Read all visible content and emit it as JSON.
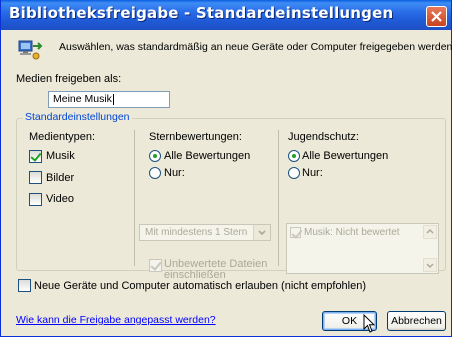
{
  "window": {
    "title": "Bibliotheksfreigabe - Standardeinstellungen"
  },
  "header": {
    "description": "Auswählen, was standardmäßig an neue Geräte oder Computer freigegeben werden soll",
    "icon": "network-share-icon"
  },
  "media_name": {
    "label": "Medien freigeben als:",
    "value": "Meine Musik"
  },
  "defaults_group": {
    "legend": "Standardeinstellungen",
    "media_types": {
      "heading": "Medientypen:",
      "items": [
        {
          "label": "Musik",
          "checked": true
        },
        {
          "label": "Bilder",
          "checked": false
        },
        {
          "label": "Video",
          "checked": false
        }
      ]
    },
    "star_ratings": {
      "heading": "Sternbewertungen:",
      "all_label": "Alle Bewertungen",
      "only_label": "Nur:",
      "selected": "all",
      "dropdown_value": "Mit mindestens 1 Stern",
      "unrated_label_line1": "Unbewertete Dateien",
      "unrated_label_line2": "einschließen",
      "unrated_checked": true
    },
    "parental": {
      "heading": "Jugendschutz:",
      "all_label": "Alle Bewertungen",
      "only_label": "Nur:",
      "selected": "all",
      "list_item": "Musik: Nicht bewertet",
      "list_item_checked": true
    }
  },
  "auto_allow": {
    "label": "Neue Geräte und Computer automatisch erlauben (nicht empfohlen)",
    "checked": false
  },
  "footer": {
    "help_link": "Wie kann die Freigabe angepasst werden?",
    "ok_label": "OK",
    "cancel_label": "Abbrechen"
  },
  "colors": {
    "title_bar": "#2a6ce8",
    "dialog_bg": "#ece9d8",
    "group_legend": "#0046d5",
    "link": "#0000ff",
    "check_green": "#21a121",
    "close_red": "#d0532f"
  }
}
